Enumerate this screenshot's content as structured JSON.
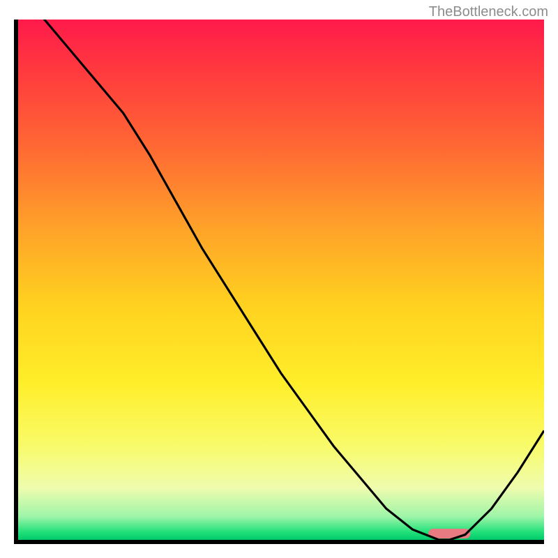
{
  "watermark": "TheBottleneck.com",
  "chart_data": {
    "type": "line",
    "title": "",
    "xlabel": "",
    "ylabel": "",
    "xlim": [
      0,
      100
    ],
    "ylim": [
      0,
      100
    ],
    "x": [
      0,
      5,
      10,
      15,
      20,
      25,
      30,
      35,
      40,
      45,
      50,
      55,
      60,
      65,
      70,
      75,
      80,
      82,
      85,
      90,
      95,
      100
    ],
    "values": [
      106,
      100,
      94,
      88,
      82,
      74,
      65,
      56,
      48,
      40,
      32,
      25,
      18,
      12,
      6,
      2,
      0,
      0,
      1,
      6,
      13,
      21
    ],
    "marker": {
      "x_start": 78,
      "x_end": 86,
      "y": 1.2,
      "color": "#e77b81"
    },
    "gradient_stops": [
      {
        "offset": 0.0,
        "color": "#ff1a4b"
      },
      {
        "offset": 0.1,
        "color": "#ff3a3e"
      },
      {
        "offset": 0.25,
        "color": "#ff6a33"
      },
      {
        "offset": 0.4,
        "color": "#ffa229"
      },
      {
        "offset": 0.55,
        "color": "#ffd21f"
      },
      {
        "offset": 0.7,
        "color": "#ffee2a"
      },
      {
        "offset": 0.82,
        "color": "#f8fb6a"
      },
      {
        "offset": 0.9,
        "color": "#effcae"
      },
      {
        "offset": 0.955,
        "color": "#9ef5a8"
      },
      {
        "offset": 0.985,
        "color": "#22e07a"
      },
      {
        "offset": 1.0,
        "color": "#00c96a"
      }
    ]
  }
}
